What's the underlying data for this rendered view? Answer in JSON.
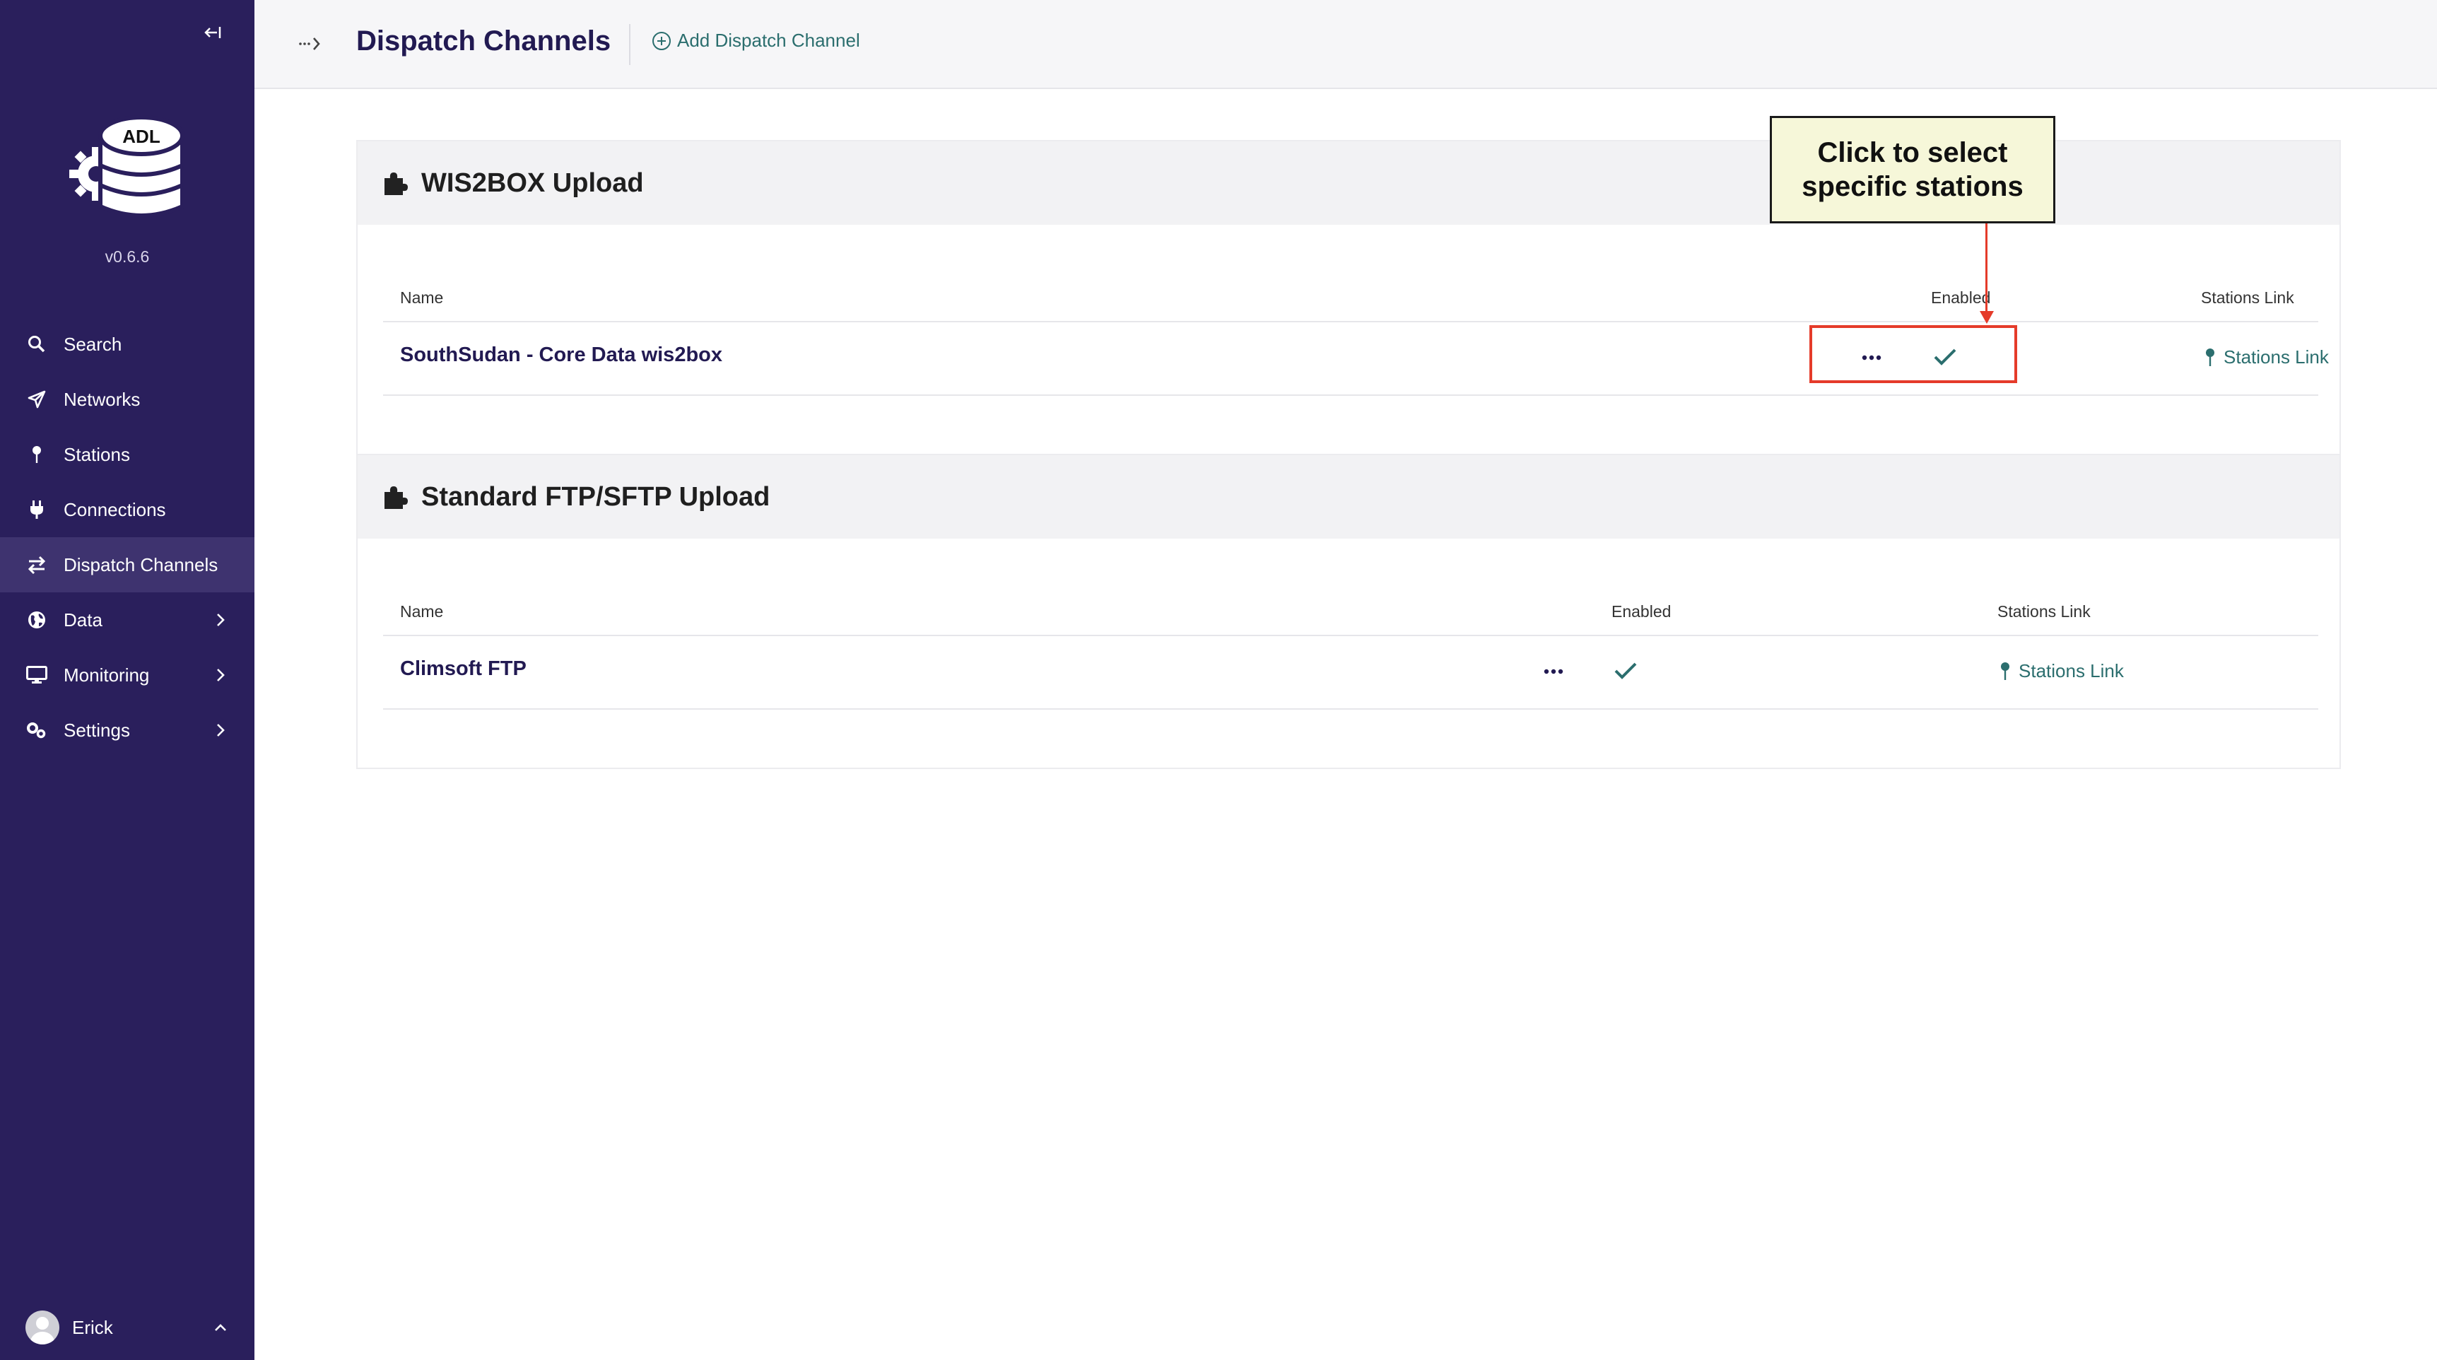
{
  "sidebar": {
    "logo_text": "ADL",
    "version": "v0.6.6",
    "items": [
      {
        "label": "Search",
        "icon": "search-icon"
      },
      {
        "label": "Networks",
        "icon": "send-icon"
      },
      {
        "label": "Stations",
        "icon": "pin-icon"
      },
      {
        "label": "Connections",
        "icon": "plug-icon"
      },
      {
        "label": "Dispatch Channels",
        "icon": "swap-icon",
        "active": true
      },
      {
        "label": "Data",
        "icon": "globe-icon",
        "has_children": true
      },
      {
        "label": "Monitoring",
        "icon": "monitor-icon",
        "has_children": true
      },
      {
        "label": "Settings",
        "icon": "cogs-icon",
        "has_children": true
      }
    ],
    "user": {
      "name": "Erick"
    }
  },
  "header": {
    "title": "Dispatch Channels",
    "add_button": "Add Dispatch Channel"
  },
  "sections": [
    {
      "title": "WIS2BOX Upload",
      "columns": {
        "name": "Name",
        "enabled": "Enabled",
        "stations": "Stations Link"
      },
      "rows": [
        {
          "name": "SouthSudan - Core Data wis2box",
          "enabled": true,
          "stations_link": "Stations Link"
        }
      ]
    },
    {
      "title": "Standard FTP/SFTP Upload",
      "columns": {
        "name": "Name",
        "enabled": "Enabled",
        "stations": "Stations Link"
      },
      "rows": [
        {
          "name": "Climsoft FTP",
          "enabled": true,
          "stations_link": "Stations Link"
        }
      ]
    }
  ],
  "annotation": {
    "callout_text": "Click to select specific stations",
    "highlight_color": "#e53b2a"
  },
  "colors": {
    "sidebar_bg": "#2a1f5c",
    "accent": "#2b6e6e",
    "title": "#221a52"
  }
}
